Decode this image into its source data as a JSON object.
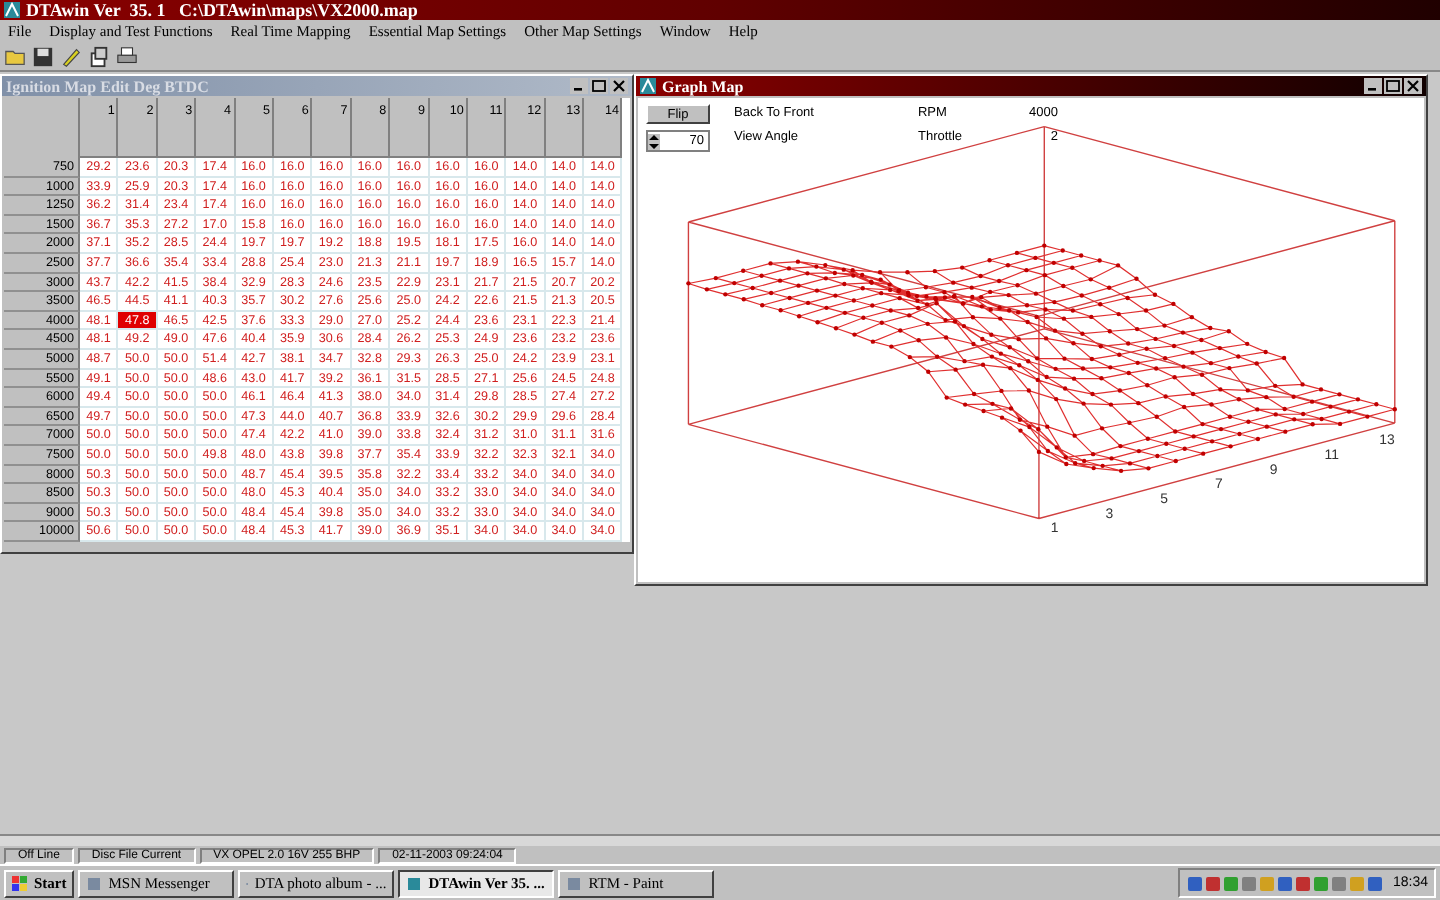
{
  "window": {
    "title": "DTAwin Ver  35. 1   C:\\DTAwin\\maps\\VX2000.map"
  },
  "menu": [
    "File",
    "Display and Test Functions",
    "Real Time Mapping",
    "Essential Map Settings",
    "Other Map Settings",
    "Window",
    "Help"
  ],
  "map_window": {
    "title": "Ignition Map Edit Deg BTDC",
    "active": false,
    "columns": [
      "1",
      "2",
      "3",
      "4",
      "5",
      "6",
      "7",
      "8",
      "9",
      "10",
      "11",
      "12",
      "13",
      "14"
    ],
    "rows": [
      {
        "rpm": "750",
        "cells": [
          {
            "value": "29.2",
            "selected": false
          },
          {
            "value": "23.6",
            "selected": false
          },
          {
            "value": "20.3",
            "selected": false
          },
          {
            "value": "17.4",
            "selected": false
          },
          {
            "value": "16.0",
            "selected": false
          },
          {
            "value": "16.0",
            "selected": false
          },
          {
            "value": "16.0",
            "selected": false
          },
          {
            "value": "16.0",
            "selected": false
          },
          {
            "value": "16.0",
            "selected": false
          },
          {
            "value": "16.0",
            "selected": false
          },
          {
            "value": "16.0",
            "selected": false
          },
          {
            "value": "14.0",
            "selected": false
          },
          {
            "value": "14.0",
            "selected": false
          },
          {
            "value": "14.0",
            "selected": false
          }
        ]
      },
      {
        "rpm": "1000",
        "cells": [
          {
            "value": "33.9",
            "selected": false
          },
          {
            "value": "25.9",
            "selected": false
          },
          {
            "value": "20.3",
            "selected": false
          },
          {
            "value": "17.4",
            "selected": false
          },
          {
            "value": "16.0",
            "selected": false
          },
          {
            "value": "16.0",
            "selected": false
          },
          {
            "value": "16.0",
            "selected": false
          },
          {
            "value": "16.0",
            "selected": false
          },
          {
            "value": "16.0",
            "selected": false
          },
          {
            "value": "16.0",
            "selected": false
          },
          {
            "value": "16.0",
            "selected": false
          },
          {
            "value": "14.0",
            "selected": false
          },
          {
            "value": "14.0",
            "selected": false
          },
          {
            "value": "14.0",
            "selected": false
          }
        ]
      },
      {
        "rpm": "1250",
        "cells": [
          {
            "value": "36.2",
            "selected": false
          },
          {
            "value": "31.4",
            "selected": false
          },
          {
            "value": "23.4",
            "selected": false
          },
          {
            "value": "17.4",
            "selected": false
          },
          {
            "value": "16.0",
            "selected": false
          },
          {
            "value": "16.0",
            "selected": false
          },
          {
            "value": "16.0",
            "selected": false
          },
          {
            "value": "16.0",
            "selected": false
          },
          {
            "value": "16.0",
            "selected": false
          },
          {
            "value": "16.0",
            "selected": false
          },
          {
            "value": "16.0",
            "selected": false
          },
          {
            "value": "14.0",
            "selected": false
          },
          {
            "value": "14.0",
            "selected": false
          },
          {
            "value": "14.0",
            "selected": false
          }
        ]
      },
      {
        "rpm": "1500",
        "cells": [
          {
            "value": "36.7",
            "selected": false
          },
          {
            "value": "35.3",
            "selected": false
          },
          {
            "value": "27.2",
            "selected": false
          },
          {
            "value": "17.0",
            "selected": false
          },
          {
            "value": "15.8",
            "selected": false
          },
          {
            "value": "16.0",
            "selected": false
          },
          {
            "value": "16.0",
            "selected": false
          },
          {
            "value": "16.0",
            "selected": false
          },
          {
            "value": "16.0",
            "selected": false
          },
          {
            "value": "16.0",
            "selected": false
          },
          {
            "value": "16.0",
            "selected": false
          },
          {
            "value": "14.0",
            "selected": false
          },
          {
            "value": "14.0",
            "selected": false
          },
          {
            "value": "14.0",
            "selected": false
          }
        ]
      },
      {
        "rpm": "2000",
        "cells": [
          {
            "value": "37.1",
            "selected": false
          },
          {
            "value": "35.2",
            "selected": false
          },
          {
            "value": "28.5",
            "selected": false
          },
          {
            "value": "24.4",
            "selected": false
          },
          {
            "value": "19.7",
            "selected": false
          },
          {
            "value": "19.7",
            "selected": false
          },
          {
            "value": "19.2",
            "selected": false
          },
          {
            "value": "18.8",
            "selected": false
          },
          {
            "value": "19.5",
            "selected": false
          },
          {
            "value": "18.1",
            "selected": false
          },
          {
            "value": "17.5",
            "selected": false
          },
          {
            "value": "16.0",
            "selected": false
          },
          {
            "value": "14.0",
            "selected": false
          },
          {
            "value": "14.0",
            "selected": false
          }
        ]
      },
      {
        "rpm": "2500",
        "cells": [
          {
            "value": "37.7",
            "selected": false
          },
          {
            "value": "36.6",
            "selected": false
          },
          {
            "value": "35.4",
            "selected": false
          },
          {
            "value": "33.4",
            "selected": false
          },
          {
            "value": "28.8",
            "selected": false
          },
          {
            "value": "25.4",
            "selected": false
          },
          {
            "value": "23.0",
            "selected": false
          },
          {
            "value": "21.3",
            "selected": false
          },
          {
            "value": "21.1",
            "selected": false
          },
          {
            "value": "19.7",
            "selected": false
          },
          {
            "value": "18.9",
            "selected": false
          },
          {
            "value": "16.5",
            "selected": false
          },
          {
            "value": "15.7",
            "selected": false
          },
          {
            "value": "14.0",
            "selected": false
          }
        ]
      },
      {
        "rpm": "3000",
        "cells": [
          {
            "value": "43.7",
            "selected": false
          },
          {
            "value": "42.2",
            "selected": false
          },
          {
            "value": "41.5",
            "selected": false
          },
          {
            "value": "38.4",
            "selected": false
          },
          {
            "value": "32.9",
            "selected": false
          },
          {
            "value": "28.3",
            "selected": false
          },
          {
            "value": "24.6",
            "selected": false
          },
          {
            "value": "23.5",
            "selected": false
          },
          {
            "value": "22.9",
            "selected": false
          },
          {
            "value": "23.1",
            "selected": false
          },
          {
            "value": "21.7",
            "selected": false
          },
          {
            "value": "21.5",
            "selected": false
          },
          {
            "value": "20.7",
            "selected": false
          },
          {
            "value": "20.2",
            "selected": false
          }
        ]
      },
      {
        "rpm": "3500",
        "cells": [
          {
            "value": "46.5",
            "selected": false
          },
          {
            "value": "44.5",
            "selected": false
          },
          {
            "value": "41.1",
            "selected": false
          },
          {
            "value": "40.3",
            "selected": false
          },
          {
            "value": "35.7",
            "selected": false
          },
          {
            "value": "30.2",
            "selected": false
          },
          {
            "value": "27.6",
            "selected": false
          },
          {
            "value": "25.6",
            "selected": false
          },
          {
            "value": "25.0",
            "selected": false
          },
          {
            "value": "24.2",
            "selected": false
          },
          {
            "value": "22.6",
            "selected": false
          },
          {
            "value": "21.5",
            "selected": false
          },
          {
            "value": "21.3",
            "selected": false
          },
          {
            "value": "20.5",
            "selected": false
          }
        ]
      },
      {
        "rpm": "4000",
        "cells": [
          {
            "value": "48.1",
            "selected": false
          },
          {
            "value": "47.8",
            "selected": true
          },
          {
            "value": "46.5",
            "selected": false
          },
          {
            "value": "42.5",
            "selected": false
          },
          {
            "value": "37.6",
            "selected": false
          },
          {
            "value": "33.3",
            "selected": false
          },
          {
            "value": "29.0",
            "selected": false
          },
          {
            "value": "27.0",
            "selected": false
          },
          {
            "value": "25.2",
            "selected": false
          },
          {
            "value": "24.4",
            "selected": false
          },
          {
            "value": "23.6",
            "selected": false
          },
          {
            "value": "23.1",
            "selected": false
          },
          {
            "value": "22.3",
            "selected": false
          },
          {
            "value": "21.4",
            "selected": false
          }
        ]
      },
      {
        "rpm": "4500",
        "cells": [
          {
            "value": "48.1",
            "selected": false
          },
          {
            "value": "49.2",
            "selected": false
          },
          {
            "value": "49.0",
            "selected": false
          },
          {
            "value": "47.6",
            "selected": false
          },
          {
            "value": "40.4",
            "selected": false
          },
          {
            "value": "35.9",
            "selected": false
          },
          {
            "value": "30.6",
            "selected": false
          },
          {
            "value": "28.4",
            "selected": false
          },
          {
            "value": "26.2",
            "selected": false
          },
          {
            "value": "25.3",
            "selected": false
          },
          {
            "value": "24.9",
            "selected": false
          },
          {
            "value": "23.6",
            "selected": false
          },
          {
            "value": "23.2",
            "selected": false
          },
          {
            "value": "23.6",
            "selected": false
          }
        ]
      },
      {
        "rpm": "5000",
        "cells": [
          {
            "value": "48.7",
            "selected": false
          },
          {
            "value": "50.0",
            "selected": false
          },
          {
            "value": "50.0",
            "selected": false
          },
          {
            "value": "51.4",
            "selected": false
          },
          {
            "value": "42.7",
            "selected": false
          },
          {
            "value": "38.1",
            "selected": false
          },
          {
            "value": "34.7",
            "selected": false
          },
          {
            "value": "32.8",
            "selected": false
          },
          {
            "value": "29.3",
            "selected": false
          },
          {
            "value": "26.3",
            "selected": false
          },
          {
            "value": "25.0",
            "selected": false
          },
          {
            "value": "24.2",
            "selected": false
          },
          {
            "value": "23.9",
            "selected": false
          },
          {
            "value": "23.1",
            "selected": false
          }
        ]
      },
      {
        "rpm": "5500",
        "cells": [
          {
            "value": "49.1",
            "selected": false
          },
          {
            "value": "50.0",
            "selected": false
          },
          {
            "value": "50.0",
            "selected": false
          },
          {
            "value": "48.6",
            "selected": false
          },
          {
            "value": "43.0",
            "selected": false
          },
          {
            "value": "41.7",
            "selected": false
          },
          {
            "value": "39.2",
            "selected": false
          },
          {
            "value": "36.1",
            "selected": false
          },
          {
            "value": "31.5",
            "selected": false
          },
          {
            "value": "28.5",
            "selected": false
          },
          {
            "value": "27.1",
            "selected": false
          },
          {
            "value": "25.6",
            "selected": false
          },
          {
            "value": "24.5",
            "selected": false
          },
          {
            "value": "24.8",
            "selected": false
          }
        ]
      },
      {
        "rpm": "6000",
        "cells": [
          {
            "value": "49.4",
            "selected": false
          },
          {
            "value": "50.0",
            "selected": false
          },
          {
            "value": "50.0",
            "selected": false
          },
          {
            "value": "50.0",
            "selected": false
          },
          {
            "value": "46.1",
            "selected": false
          },
          {
            "value": "46.4",
            "selected": false
          },
          {
            "value": "41.3",
            "selected": false
          },
          {
            "value": "38.0",
            "selected": false
          },
          {
            "value": "34.0",
            "selected": false
          },
          {
            "value": "31.4",
            "selected": false
          },
          {
            "value": "29.8",
            "selected": false
          },
          {
            "value": "28.5",
            "selected": false
          },
          {
            "value": "27.4",
            "selected": false
          },
          {
            "value": "27.2",
            "selected": false
          }
        ]
      },
      {
        "rpm": "6500",
        "cells": [
          {
            "value": "49.7",
            "selected": false
          },
          {
            "value": "50.0",
            "selected": false
          },
          {
            "value": "50.0",
            "selected": false
          },
          {
            "value": "50.0",
            "selected": false
          },
          {
            "value": "47.3",
            "selected": false
          },
          {
            "value": "44.0",
            "selected": false
          },
          {
            "value": "40.7",
            "selected": false
          },
          {
            "value": "36.8",
            "selected": false
          },
          {
            "value": "33.9",
            "selected": false
          },
          {
            "value": "32.6",
            "selected": false
          },
          {
            "value": "30.2",
            "selected": false
          },
          {
            "value": "29.9",
            "selected": false
          },
          {
            "value": "29.6",
            "selected": false
          },
          {
            "value": "28.4",
            "selected": false
          }
        ]
      },
      {
        "rpm": "7000",
        "cells": [
          {
            "value": "50.0",
            "selected": false
          },
          {
            "value": "50.0",
            "selected": false
          },
          {
            "value": "50.0",
            "selected": false
          },
          {
            "value": "50.0",
            "selected": false
          },
          {
            "value": "47.4",
            "selected": false
          },
          {
            "value": "42.2",
            "selected": false
          },
          {
            "value": "41.0",
            "selected": false
          },
          {
            "value": "39.0",
            "selected": false
          },
          {
            "value": "33.8",
            "selected": false
          },
          {
            "value": "32.4",
            "selected": false
          },
          {
            "value": "31.2",
            "selected": false
          },
          {
            "value": "31.0",
            "selected": false
          },
          {
            "value": "31.1",
            "selected": false
          },
          {
            "value": "31.6",
            "selected": false
          }
        ]
      },
      {
        "rpm": "7500",
        "cells": [
          {
            "value": "50.0",
            "selected": false
          },
          {
            "value": "50.0",
            "selected": false
          },
          {
            "value": "50.0",
            "selected": false
          },
          {
            "value": "49.8",
            "selected": false
          },
          {
            "value": "48.0",
            "selected": false
          },
          {
            "value": "43.8",
            "selected": false
          },
          {
            "value": "39.8",
            "selected": false
          },
          {
            "value": "37.7",
            "selected": false
          },
          {
            "value": "35.4",
            "selected": false
          },
          {
            "value": "33.9",
            "selected": false
          },
          {
            "value": "32.2",
            "selected": false
          },
          {
            "value": "32.3",
            "selected": false
          },
          {
            "value": "32.1",
            "selected": false
          },
          {
            "value": "34.0",
            "selected": false
          }
        ]
      },
      {
        "rpm": "8000",
        "cells": [
          {
            "value": "50.3",
            "selected": false
          },
          {
            "value": "50.0",
            "selected": false
          },
          {
            "value": "50.0",
            "selected": false
          },
          {
            "value": "50.0",
            "selected": false
          },
          {
            "value": "48.7",
            "selected": false
          },
          {
            "value": "45.4",
            "selected": false
          },
          {
            "value": "39.5",
            "selected": false
          },
          {
            "value": "35.8",
            "selected": false
          },
          {
            "value": "32.2",
            "selected": false
          },
          {
            "value": "33.4",
            "selected": false
          },
          {
            "value": "33.2",
            "selected": false
          },
          {
            "value": "34.0",
            "selected": false
          },
          {
            "value": "34.0",
            "selected": false
          },
          {
            "value": "34.0",
            "selected": false
          }
        ]
      },
      {
        "rpm": "8500",
        "cells": [
          {
            "value": "50.3",
            "selected": false
          },
          {
            "value": "50.0",
            "selected": false
          },
          {
            "value": "50.0",
            "selected": false
          },
          {
            "value": "50.0",
            "selected": false
          },
          {
            "value": "48.0",
            "selected": false
          },
          {
            "value": "45.3",
            "selected": false
          },
          {
            "value": "40.4",
            "selected": false
          },
          {
            "value": "35.0",
            "selected": false
          },
          {
            "value": "34.0",
            "selected": false
          },
          {
            "value": "33.2",
            "selected": false
          },
          {
            "value": "33.0",
            "selected": false
          },
          {
            "value": "34.0",
            "selected": false
          },
          {
            "value": "34.0",
            "selected": false
          },
          {
            "value": "34.0",
            "selected": false
          }
        ]
      },
      {
        "rpm": "9000",
        "cells": [
          {
            "value": "50.3",
            "selected": false
          },
          {
            "value": "50.0",
            "selected": false
          },
          {
            "value": "50.0",
            "selected": false
          },
          {
            "value": "50.0",
            "selected": false
          },
          {
            "value": "48.4",
            "selected": false
          },
          {
            "value": "45.4",
            "selected": false
          },
          {
            "value": "39.8",
            "selected": false
          },
          {
            "value": "35.0",
            "selected": false
          },
          {
            "value": "34.0",
            "selected": false
          },
          {
            "value": "33.2",
            "selected": false
          },
          {
            "value": "33.0",
            "selected": false
          },
          {
            "value": "34.0",
            "selected": false
          },
          {
            "value": "34.0",
            "selected": false
          },
          {
            "value": "34.0",
            "selected": false
          }
        ]
      },
      {
        "rpm": "10000",
        "cells": [
          {
            "value": "50.6",
            "selected": false
          },
          {
            "value": "50.0",
            "selected": false
          },
          {
            "value": "50.0",
            "selected": false
          },
          {
            "value": "50.0",
            "selected": false
          },
          {
            "value": "48.4",
            "selected": false
          },
          {
            "value": "45.3",
            "selected": false
          },
          {
            "value": "41.7",
            "selected": false
          },
          {
            "value": "39.0",
            "selected": false
          },
          {
            "value": "36.9",
            "selected": false
          },
          {
            "value": "35.1",
            "selected": false
          },
          {
            "value": "34.0",
            "selected": false
          },
          {
            "value": "34.0",
            "selected": false
          },
          {
            "value": "34.0",
            "selected": false
          },
          {
            "value": "34.0",
            "selected": false
          }
        ]
      }
    ]
  },
  "graph_window": {
    "title": "Graph Map",
    "active": true,
    "flip_button": "Flip",
    "back_to_front": "Back To Front",
    "view_angle_label": "View Angle",
    "view_angle": "70",
    "rpm_label": "RPM",
    "rpm": "4000",
    "throttle_label": "Throttle",
    "throttle": "2",
    "axis_labels": [
      "1",
      "3",
      "5",
      "7",
      "9",
      "11",
      "13"
    ]
  },
  "status_bar": [
    "Off Line",
    "Disc File Current",
    "VX OPEL 2.0 16V 255 BHP",
    "02-11-2003 09:24:04"
  ],
  "taskbar": {
    "start": "Start",
    "tasks": [
      {
        "label": "MSN Messenger",
        "selected": false
      },
      {
        "label": "DTA photo album - ...",
        "selected": false
      },
      {
        "label": "DTAwin Ver  35. ...",
        "selected": true
      },
      {
        "label": "RTM - Paint",
        "selected": false
      }
    ],
    "clock": "18:34"
  }
}
